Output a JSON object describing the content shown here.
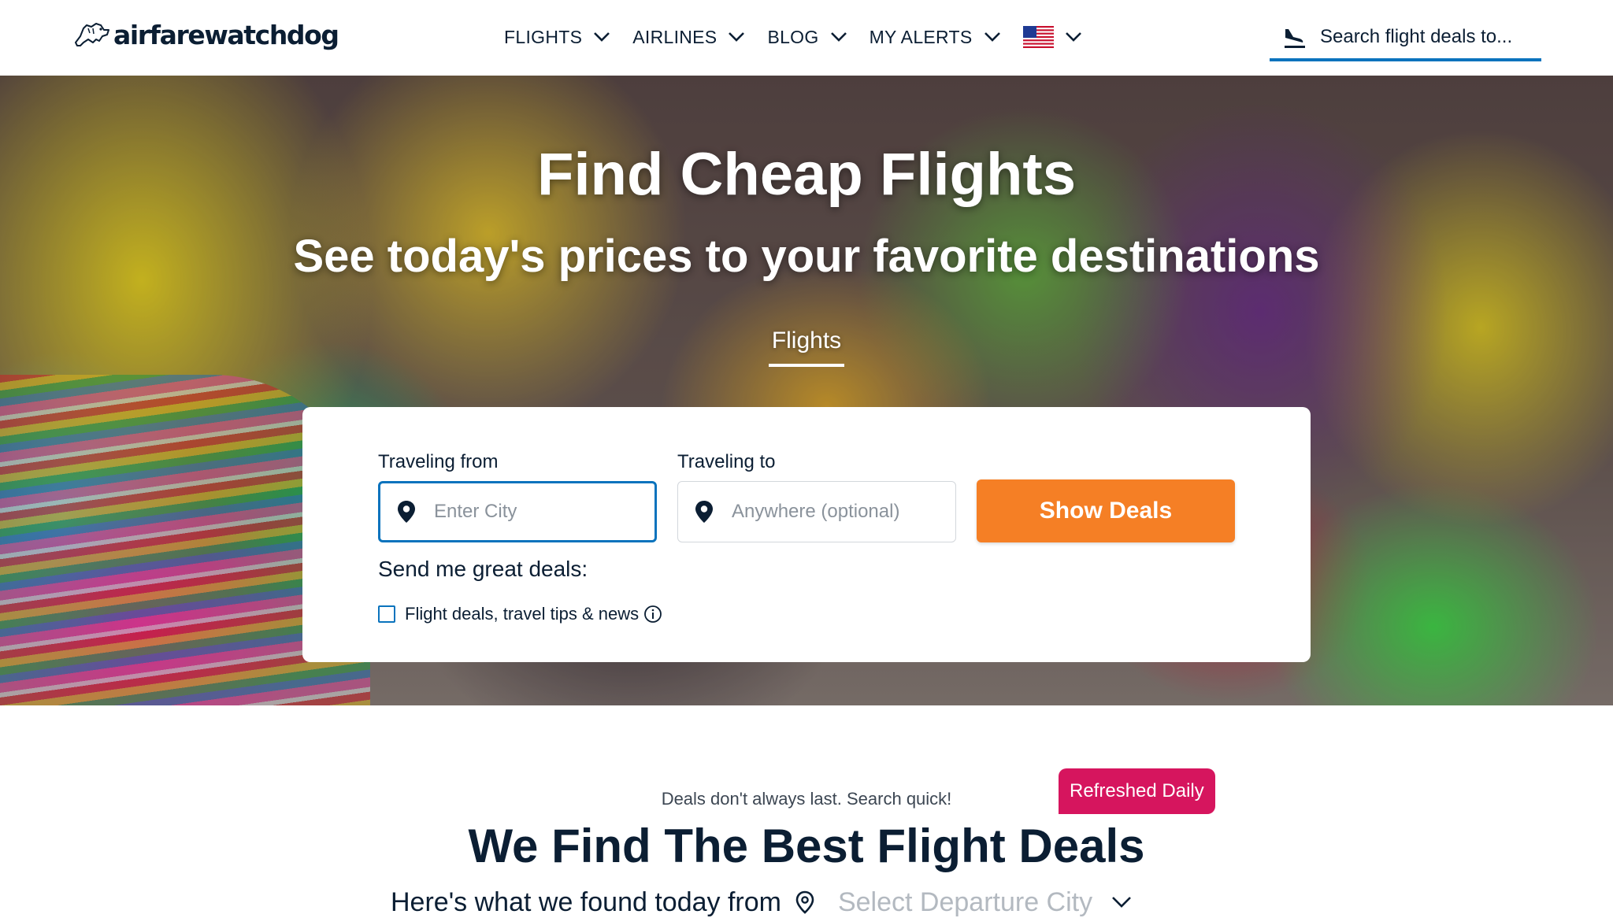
{
  "header": {
    "logo_text": "airfarewatchdog",
    "nav": [
      {
        "label": "FLIGHTS"
      },
      {
        "label": "AIRLINES"
      },
      {
        "label": "BLOG"
      },
      {
        "label": "MY ALERTS"
      }
    ],
    "country_flag_icon": "us-flag-icon",
    "search_placeholder": "Search flight deals to..."
  },
  "hero": {
    "title": "Find Cheap Flights",
    "subtitle": "See today's prices to your favorite destinations",
    "active_tab": "Flights"
  },
  "search_form": {
    "from_label": "Traveling from",
    "from_placeholder": "Enter City",
    "to_label": "Traveling to",
    "to_placeholder": "Anywhere (optional)",
    "submit_label": "Show Deals",
    "send_label": "Send me great deals:",
    "option_label": "Flight deals, travel tips & news",
    "option_checked": false
  },
  "deals_section": {
    "tagline": "Deals don't always last. Search quick!",
    "badge": "Refreshed Daily",
    "title": "We Find The Best Flight Deals",
    "found_prefix": "Here's what we found today from",
    "city_placeholder": "Select Departure City"
  },
  "colors": {
    "brand_navy": "#0b1e33",
    "accent_blue": "#0a73bd",
    "cta_orange": "#f57f25",
    "badge_pink": "#d6155e"
  }
}
